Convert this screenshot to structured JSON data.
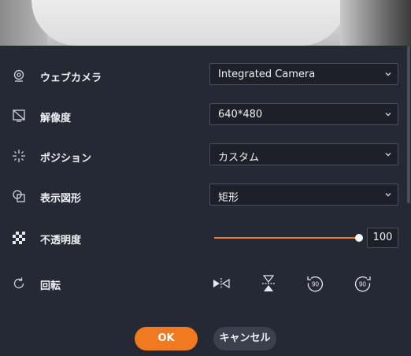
{
  "preview": {
    "icon": "webcam-preview-image"
  },
  "settings": {
    "webcam": {
      "label": "ウェブカメラ",
      "value": "Integrated Camera",
      "icon": "webcam-icon"
    },
    "resolution": {
      "label": "解像度",
      "value": "640*480",
      "icon": "resolution-icon"
    },
    "position": {
      "label": "ポジション",
      "value": "カスタム",
      "icon": "position-icon"
    },
    "shape": {
      "label": "表示図形",
      "value": "矩形",
      "icon": "shape-icon"
    },
    "opacity": {
      "label": "不透明度",
      "value": "100",
      "level_percent": 100,
      "icon": "opacity-icon"
    },
    "rotation": {
      "label": "回転",
      "icon": "rotate-icon",
      "buttons": [
        "flip-horizontal-icon",
        "flip-vertical-icon",
        "rotate-left-90-icon",
        "rotate-right-90-icon"
      ],
      "rotate_left_text": "90",
      "rotate_right_text": "90"
    }
  },
  "actions": {
    "ok_label": "OK",
    "cancel_label": "キャンセル"
  },
  "colors": {
    "accent": "#f07a1f",
    "background": "#252934",
    "field": "#1d2029"
  }
}
